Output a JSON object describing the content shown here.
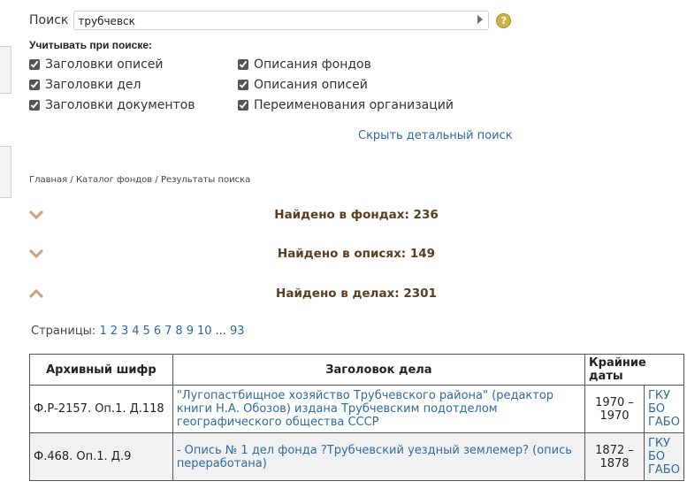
{
  "search": {
    "label": "Поиск",
    "value": "трубчевск",
    "help_icon": "?"
  },
  "options": {
    "title": "Учитывать при поиске:",
    "left": [
      "Заголовки описей",
      "Заголовки дел",
      "Заголовки документов"
    ],
    "right": [
      "Описания фондов",
      "Описания описей",
      "Переименования организаций"
    ],
    "hide_link": "Скрыть детальный поиск"
  },
  "breadcrumb": {
    "home": "Главная",
    "catalog": "Каталог фондов",
    "current": "Результаты поиска",
    "sep": " / "
  },
  "sections": {
    "funds": "Найдено в фондах: 236",
    "inventories": "Найдено в описях: 149",
    "cases": "Найдено в делах: 2301"
  },
  "pagination": {
    "label": "Страницы:",
    "pages": [
      "1",
      "2",
      "3",
      "4",
      "5",
      "6",
      "7",
      "8",
      "9",
      "10"
    ],
    "ellipsis": "...",
    "last": "93"
  },
  "table": {
    "headers": {
      "code": "Архивный шифр",
      "title": "Заголовок дела",
      "dates": "Крайние даты"
    },
    "rows": [
      {
        "code": "Ф.Р-2157. Оп.1. Д.118",
        "title": "\"Лугопастбищное хозяйство Трубчевского района\" (редактор книги Н.А. Обозов) издана Трубчевским подотделом географического общества СССР",
        "dates": "1970 – 1970",
        "archive": "ГКУ БО ГАБО"
      },
      {
        "code": "Ф.468. Оп.1. Д.9",
        "title": "- Опись № 1 дел фонда ?Трубчевский уездный землемер? (опись переработана)",
        "dates": "1872 – 1878",
        "archive": "ГКУ БО ГАБО"
      }
    ]
  },
  "colors": {
    "link": "#2f6aa0",
    "section_title": "#5a3e1f",
    "chevron": "#c9a27a"
  }
}
